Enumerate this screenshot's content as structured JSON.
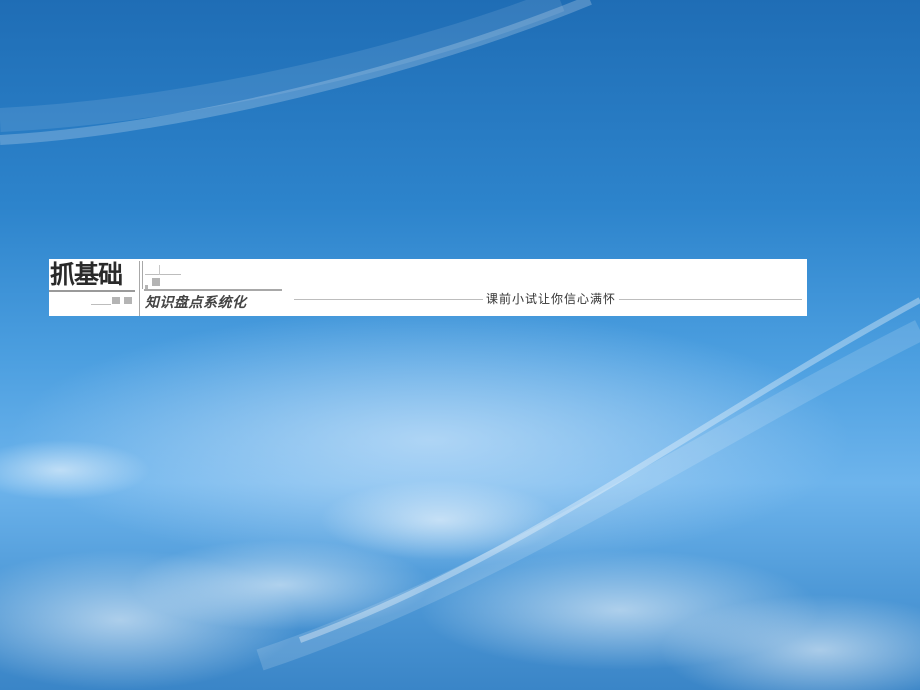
{
  "section_banner": {
    "title": "抓基础",
    "subtitle": "知识盘点系统化",
    "motto": "课前小试让你信心满怀"
  },
  "colors": {
    "sky_top": "#1f6db5",
    "sky_mid": "#4c9fe0",
    "banner_background": "#ffffff",
    "banner_text": "#333333"
  }
}
